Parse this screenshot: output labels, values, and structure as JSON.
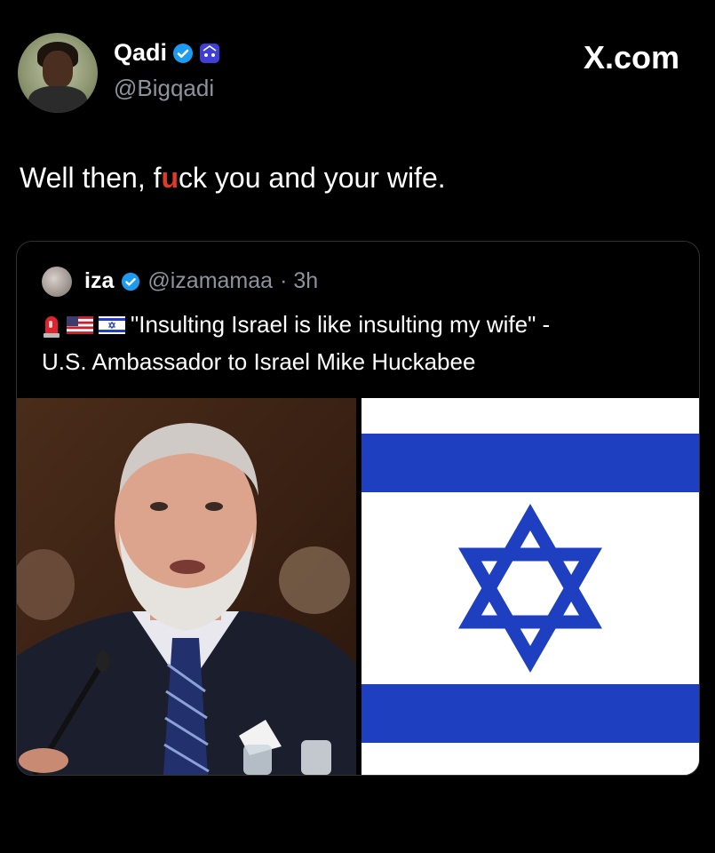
{
  "header": {
    "name": "Qadi",
    "handle": "@Bigqadi",
    "watermark": "X.com",
    "verified_color": "#1d9bf0"
  },
  "tweet": {
    "text_before": "Well then, f",
    "text_censored": "u",
    "text_middle": "ck",
    "text_after": " you and your wife."
  },
  "quoted": {
    "name": "iza",
    "handle": "@izamamaa",
    "time": "· 3h",
    "line1": "\"Insulting Israel is like insulting my wife\" -",
    "line2": "U.S. Ambassador to Israel Mike Huckabee",
    "icons": [
      "siren-icon",
      "us-flag-icon",
      "israel-flag-icon"
    ]
  },
  "colors": {
    "flag_blue": "#1e3fbf",
    "background": "#000000"
  }
}
